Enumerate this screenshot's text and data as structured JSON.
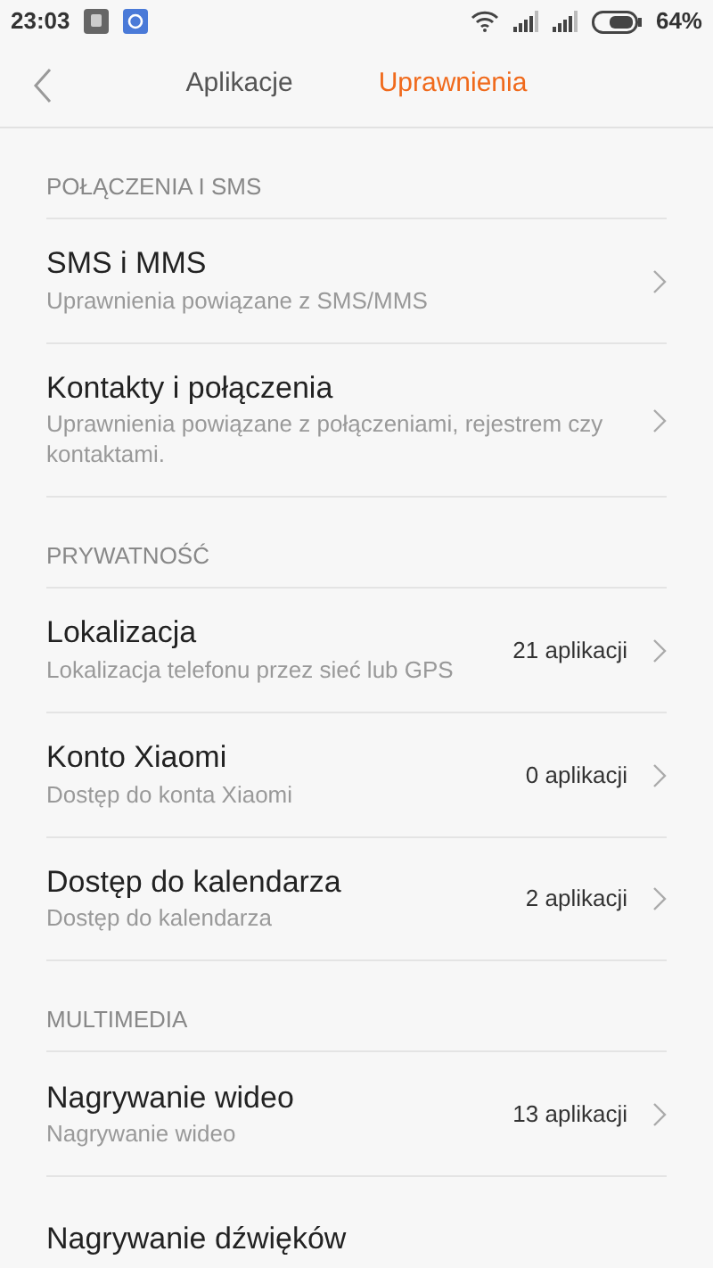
{
  "status_bar": {
    "time": "23:03",
    "battery_text": "64%"
  },
  "tabs": [
    {
      "label": "Aplikacje",
      "selected": false
    },
    {
      "label": "Uprawnienia",
      "selected": true
    }
  ],
  "sections": [
    {
      "title": "POŁĄCZENIA I SMS",
      "items": [
        {
          "title": "SMS i MMS",
          "subtitle": "Uprawnienia powiązane z SMS/MMS"
        },
        {
          "title": "Kontakty i połączenia",
          "subtitle": "Uprawnienia powiązane z połączeniami, rejestrem czy kontaktami."
        }
      ]
    },
    {
      "title": "PRYWATNOŚĆ",
      "items": [
        {
          "title": "Lokalizacja",
          "subtitle": "Lokalizacja telefonu przez sieć lub GPS",
          "count": "21 aplikacji"
        },
        {
          "title": "Konto Xiaomi",
          "subtitle": "Dostęp do konta Xiaomi",
          "count": "0 aplikacji"
        },
        {
          "title": "Dostęp do kalendarza",
          "subtitle": "Dostęp do kalendarza",
          "count": "2 aplikacji"
        }
      ]
    },
    {
      "title": "MULTIMEDIA",
      "items": [
        {
          "title": "Nagrywanie wideo",
          "subtitle": "Nagrywanie wideo",
          "count": "13 aplikacji"
        },
        {
          "title": "Nagrywanie dźwięków"
        }
      ]
    }
  ]
}
